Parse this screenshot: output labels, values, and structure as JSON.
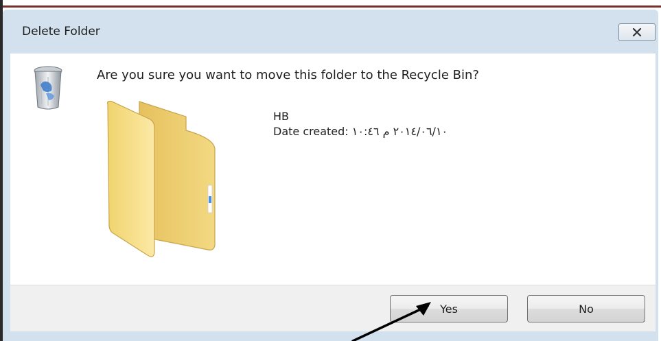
{
  "dialog": {
    "title": "Delete Folder",
    "message": "Are you sure you want to move this folder to the Recycle Bin?",
    "item": {
      "name": "HB",
      "date_created": "Date created: ٢٠١٤/٠٦/١٠ م ١٠:٤٦"
    },
    "buttons": {
      "yes": "Yes",
      "no": "No"
    },
    "icons": {
      "title_close": "close-icon",
      "message_icon": "recycle-bin-icon",
      "item_icon": "folder-icon",
      "annotation": "arrow-pointer"
    }
  }
}
